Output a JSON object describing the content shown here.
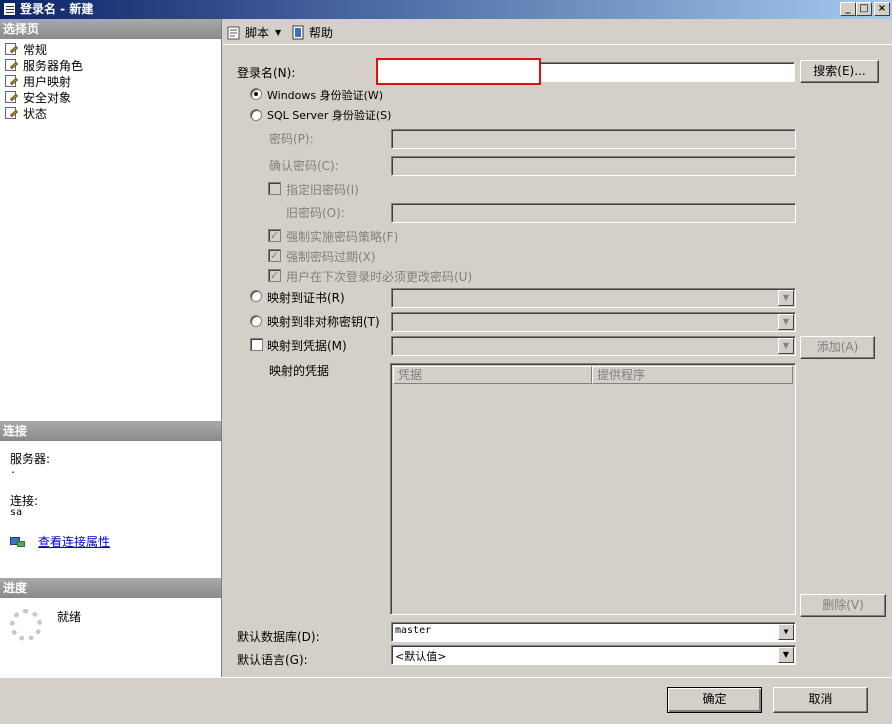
{
  "window": {
    "title": "登录名 - 新建",
    "controls": [
      "_",
      "□",
      "×"
    ]
  },
  "left": {
    "select_page_header": "选择页",
    "nav": [
      "常规",
      "服务器角色",
      "用户映射",
      "安全对象",
      "状态"
    ],
    "connection_header": "连接",
    "server_label": "服务器:",
    "server_value": ".",
    "conn_label": "连接:",
    "conn_value": "sa",
    "view_conn_link": "查看连接属性",
    "progress_header": "进度",
    "progress_status": "就绪"
  },
  "toolbar": {
    "script_label": "脚本",
    "help_label": "帮助"
  },
  "form": {
    "login_name_label": "登录名(N):",
    "login_name_value": "",
    "search_button": "搜索(E)...",
    "windows_auth": "Windows 身份验证(W)",
    "sql_auth": "SQL Server 身份验证(S)",
    "password_label": "密码(P):",
    "confirm_label": "确认密码(C):",
    "specify_old": "指定旧密码(I)",
    "old_password_label": "旧密码(O):",
    "enforce_policy": "强制实施密码策略(F)",
    "enforce_expiration": "强制密码过期(X)",
    "must_change": "用户在下次登录时必须更改密码(U)",
    "map_cert": "映射到证书(R)",
    "map_asym": "映射到非对称密钥(T)",
    "map_cred": "映射到凭据(M)",
    "add_button": "添加(A)",
    "mapped_cred_label": "映射的凭据",
    "grid_cols": [
      "凭据",
      "提供程序"
    ],
    "remove_button": "删除(V)",
    "default_db_label": "默认数据库(D):",
    "default_db_value": "master",
    "default_lang_label": "默认语言(G):",
    "default_lang_value": "<默认值>"
  },
  "footer": {
    "ok": "确定",
    "cancel": "取消"
  }
}
